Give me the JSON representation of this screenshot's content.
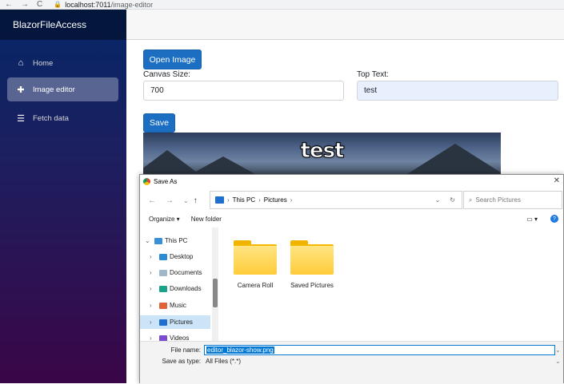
{
  "browser": {
    "nav": [
      "←",
      "→",
      "C"
    ],
    "url_host": "localhost:7011",
    "url_path": "/image-editor"
  },
  "sidebar": {
    "brand": "BlazorFileAccess",
    "items": [
      {
        "label": "Home",
        "icon": "home-icon",
        "glyph": "⌂"
      },
      {
        "label": "Image editor",
        "icon": "plus-icon",
        "glyph": "✚"
      },
      {
        "label": "Fetch data",
        "icon": "list-icon",
        "glyph": "☰"
      }
    ]
  },
  "editor": {
    "open_label": "Open Image",
    "canvas_size_label": "Canvas Size:",
    "canvas_size_value": "700",
    "top_text_label": "Top Text:",
    "top_text_value": "test",
    "save_label": "Save",
    "meme_text": "test"
  },
  "dialog": {
    "title": "Save As",
    "close": "✕",
    "back": "←",
    "forward": "→",
    "recent": "⌄",
    "up": "↑",
    "path": [
      "This PC",
      "Pictures"
    ],
    "sep": "›",
    "dropdown": "⌄",
    "refresh": "↻",
    "search_placeholder": "Search Pictures",
    "organize": "Organize ▾",
    "new_folder": "New folder",
    "view_glyph": "▭ ▾",
    "help_glyph": "?",
    "nav_items": [
      {
        "label": "This PC",
        "chev": "⌄"
      },
      {
        "label": "Desktop",
        "chev": "›"
      },
      {
        "label": "Documents",
        "chev": "›"
      },
      {
        "label": "Downloads",
        "chev": "›"
      },
      {
        "label": "Music",
        "chev": "›"
      },
      {
        "label": "Pictures",
        "chev": "›"
      },
      {
        "label": "Videos",
        "chev": "›"
      }
    ],
    "folders": [
      "Camera Roll",
      "Saved Pictures"
    ],
    "file_name_label": "File name:",
    "file_name_value": "editor_blazor-show.png",
    "save_type_label": "Save as type:",
    "save_type_value": "All Files (*.*)"
  },
  "colors": {
    "primary": "#1b6ec2",
    "sidebar_top": "#052767",
    "sidebar_bottom": "#3a0647"
  }
}
